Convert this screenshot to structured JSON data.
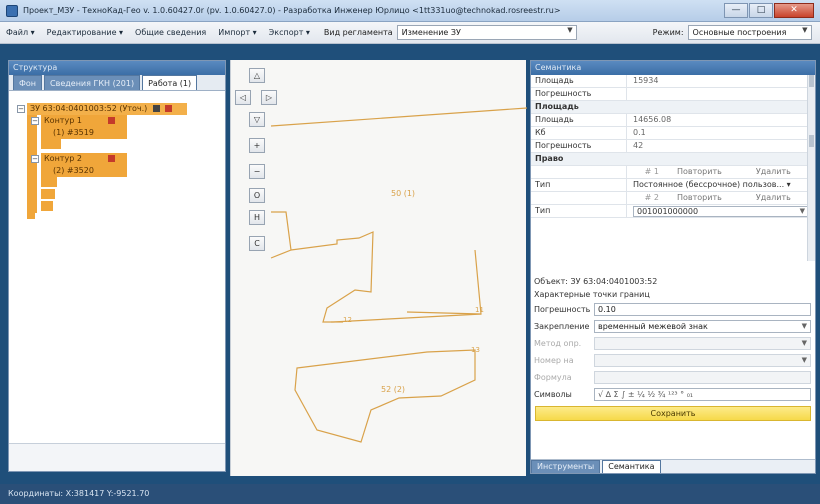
{
  "window": {
    "title": "Проект_МЗУ - ТехноКад-Гео v. 1.0.60427.0r (pv. 1.0.60427.0) - Разработка Инженер Юрлицо <1tt331uo@technokad.rosreestr.ru>",
    "controls": [
      "—",
      "□",
      "✕"
    ]
  },
  "menu": {
    "items": [
      "Файл ▾",
      "Редактирование ▾",
      "Общие сведения",
      "Импорт ▾",
      "Экспорт ▾"
    ],
    "regulation_label": "Вид регламента",
    "regulation_value": "Изменение ЗУ",
    "mode_label": "Режим:",
    "mode_value": "Основные построения"
  },
  "left_panel": {
    "header": "Структура",
    "tabs": [
      "Фон",
      "Сведения ГКН (201)",
      "Работа (1)"
    ],
    "tree": {
      "root": "ЗУ 63:04:0401003:52 (Уточ.)",
      "contour1": "Контур 1",
      "contour1_child": "(1) #3519",
      "contour2": "Контур 2",
      "contour2_child": "(2) #3520"
    }
  },
  "map": {
    "buttons": [
      "△",
      "◁",
      "▷",
      "▽",
      "+",
      "−",
      "O",
      "H",
      "C"
    ],
    "labels": {
      "top_parcel": "50 (1)",
      "bottom_parcel": "52 (2)",
      "point_a": "12",
      "point_b": "11",
      "point_c": "13"
    },
    "line_color": "#d9a24a"
  },
  "right_panel": {
    "header": "Семантика",
    "rows": [
      {
        "key": "Площадь",
        "value": "15934"
      },
      {
        "key": "Погрешность",
        "value": ""
      }
    ],
    "group_area": "Площадь",
    "area_rows": [
      {
        "key": "Площадь",
        "value": "14656.08"
      },
      {
        "key": "Кб",
        "value": "0.1"
      },
      {
        "key": "Погрешность",
        "value": "42"
      }
    ],
    "group_right": "Право",
    "right_rows": [
      {
        "num": "# 1",
        "repeat": "Повторить",
        "delete": "Удалить"
      },
      {
        "key": "Тип",
        "value": "Постоянное (бессрочное) пользов... ▾"
      },
      {
        "num": "# 2",
        "repeat": "Повторить",
        "delete": "Удалить"
      },
      {
        "key": "Тип",
        "value": "001001000000"
      }
    ],
    "object_line": "Объект: ЗУ 63:04:0401003:52",
    "points_line": "Характерные точки границ",
    "form": {
      "error_label": "Погрешность",
      "error_value": "0.10",
      "fix_label": "Закрепление",
      "fix_value": "временный межевой знак",
      "method_label": "Метод опр.",
      "formula_label": "Формула",
      "symbols_label": "Символы",
      "symbols_value": "√ ∆ Σ ∫ ± ¼ ½ ¾ ¹²³ ° ₀₁",
      "save_label": "Сохранить",
      "number_label": "Номер на"
    },
    "bottom_tabs": [
      "Инструменты",
      "Семантика"
    ]
  },
  "status": {
    "coords": "Координаты: X:381417 Y:-9521.70"
  }
}
